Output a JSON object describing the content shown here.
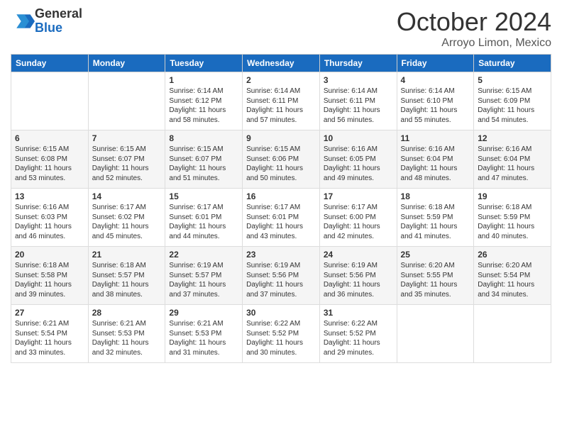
{
  "logo": {
    "general": "General",
    "blue": "Blue"
  },
  "header": {
    "month": "October 2024",
    "location": "Arroyo Limon, Mexico"
  },
  "days_of_week": [
    "Sunday",
    "Monday",
    "Tuesday",
    "Wednesday",
    "Thursday",
    "Friday",
    "Saturday"
  ],
  "weeks": [
    [
      {
        "day": "",
        "info": ""
      },
      {
        "day": "",
        "info": ""
      },
      {
        "day": "1",
        "info": "Sunrise: 6:14 AM\nSunset: 6:12 PM\nDaylight: 11 hours and 58 minutes."
      },
      {
        "day": "2",
        "info": "Sunrise: 6:14 AM\nSunset: 6:11 PM\nDaylight: 11 hours and 57 minutes."
      },
      {
        "day": "3",
        "info": "Sunrise: 6:14 AM\nSunset: 6:11 PM\nDaylight: 11 hours and 56 minutes."
      },
      {
        "day": "4",
        "info": "Sunrise: 6:14 AM\nSunset: 6:10 PM\nDaylight: 11 hours and 55 minutes."
      },
      {
        "day": "5",
        "info": "Sunrise: 6:15 AM\nSunset: 6:09 PM\nDaylight: 11 hours and 54 minutes."
      }
    ],
    [
      {
        "day": "6",
        "info": "Sunrise: 6:15 AM\nSunset: 6:08 PM\nDaylight: 11 hours and 53 minutes."
      },
      {
        "day": "7",
        "info": "Sunrise: 6:15 AM\nSunset: 6:07 PM\nDaylight: 11 hours and 52 minutes."
      },
      {
        "day": "8",
        "info": "Sunrise: 6:15 AM\nSunset: 6:07 PM\nDaylight: 11 hours and 51 minutes."
      },
      {
        "day": "9",
        "info": "Sunrise: 6:15 AM\nSunset: 6:06 PM\nDaylight: 11 hours and 50 minutes."
      },
      {
        "day": "10",
        "info": "Sunrise: 6:16 AM\nSunset: 6:05 PM\nDaylight: 11 hours and 49 minutes."
      },
      {
        "day": "11",
        "info": "Sunrise: 6:16 AM\nSunset: 6:04 PM\nDaylight: 11 hours and 48 minutes."
      },
      {
        "day": "12",
        "info": "Sunrise: 6:16 AM\nSunset: 6:04 PM\nDaylight: 11 hours and 47 minutes."
      }
    ],
    [
      {
        "day": "13",
        "info": "Sunrise: 6:16 AM\nSunset: 6:03 PM\nDaylight: 11 hours and 46 minutes."
      },
      {
        "day": "14",
        "info": "Sunrise: 6:17 AM\nSunset: 6:02 PM\nDaylight: 11 hours and 45 minutes."
      },
      {
        "day": "15",
        "info": "Sunrise: 6:17 AM\nSunset: 6:01 PM\nDaylight: 11 hours and 44 minutes."
      },
      {
        "day": "16",
        "info": "Sunrise: 6:17 AM\nSunset: 6:01 PM\nDaylight: 11 hours and 43 minutes."
      },
      {
        "day": "17",
        "info": "Sunrise: 6:17 AM\nSunset: 6:00 PM\nDaylight: 11 hours and 42 minutes."
      },
      {
        "day": "18",
        "info": "Sunrise: 6:18 AM\nSunset: 5:59 PM\nDaylight: 11 hours and 41 minutes."
      },
      {
        "day": "19",
        "info": "Sunrise: 6:18 AM\nSunset: 5:59 PM\nDaylight: 11 hours and 40 minutes."
      }
    ],
    [
      {
        "day": "20",
        "info": "Sunrise: 6:18 AM\nSunset: 5:58 PM\nDaylight: 11 hours and 39 minutes."
      },
      {
        "day": "21",
        "info": "Sunrise: 6:18 AM\nSunset: 5:57 PM\nDaylight: 11 hours and 38 minutes."
      },
      {
        "day": "22",
        "info": "Sunrise: 6:19 AM\nSunset: 5:57 PM\nDaylight: 11 hours and 37 minutes."
      },
      {
        "day": "23",
        "info": "Sunrise: 6:19 AM\nSunset: 5:56 PM\nDaylight: 11 hours and 37 minutes."
      },
      {
        "day": "24",
        "info": "Sunrise: 6:19 AM\nSunset: 5:56 PM\nDaylight: 11 hours and 36 minutes."
      },
      {
        "day": "25",
        "info": "Sunrise: 6:20 AM\nSunset: 5:55 PM\nDaylight: 11 hours and 35 minutes."
      },
      {
        "day": "26",
        "info": "Sunrise: 6:20 AM\nSunset: 5:54 PM\nDaylight: 11 hours and 34 minutes."
      }
    ],
    [
      {
        "day": "27",
        "info": "Sunrise: 6:21 AM\nSunset: 5:54 PM\nDaylight: 11 hours and 33 minutes."
      },
      {
        "day": "28",
        "info": "Sunrise: 6:21 AM\nSunset: 5:53 PM\nDaylight: 11 hours and 32 minutes."
      },
      {
        "day": "29",
        "info": "Sunrise: 6:21 AM\nSunset: 5:53 PM\nDaylight: 11 hours and 31 minutes."
      },
      {
        "day": "30",
        "info": "Sunrise: 6:22 AM\nSunset: 5:52 PM\nDaylight: 11 hours and 30 minutes."
      },
      {
        "day": "31",
        "info": "Sunrise: 6:22 AM\nSunset: 5:52 PM\nDaylight: 11 hours and 29 minutes."
      },
      {
        "day": "",
        "info": ""
      },
      {
        "day": "",
        "info": ""
      }
    ]
  ]
}
